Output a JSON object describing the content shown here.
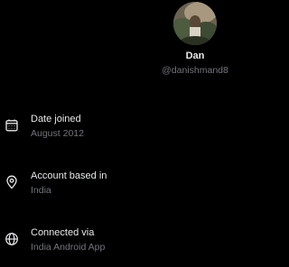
{
  "profile": {
    "display_name": "Dan",
    "handle": "@danishmand8"
  },
  "about": {
    "items": [
      {
        "icon": "calendar-icon",
        "label": "Date joined",
        "value": "August 2012"
      },
      {
        "icon": "location-pin-icon",
        "label": "Account based in",
        "value": "India"
      },
      {
        "icon": "globe-icon",
        "label": "Connected via",
        "value": "India Android App"
      }
    ]
  },
  "colors": {
    "background": "#000000",
    "primary_text": "#e7e9ea",
    "secondary_text": "#71767b"
  }
}
